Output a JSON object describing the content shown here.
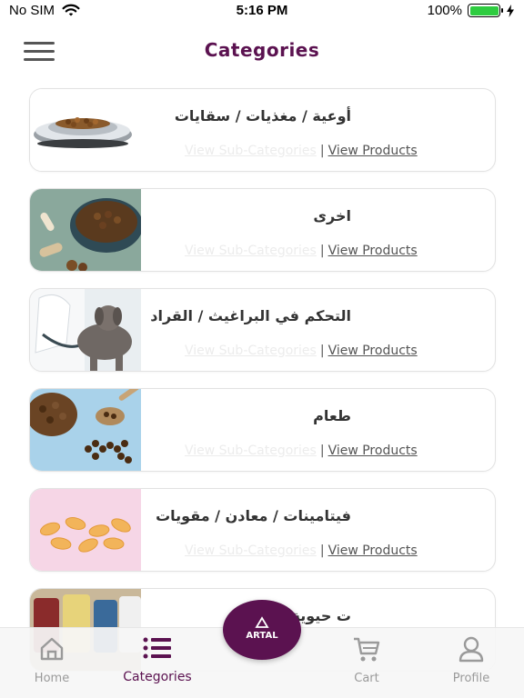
{
  "status_bar": {
    "carrier": "No SIM",
    "time": "5:16 PM",
    "battery_pct": "100%",
    "battery_level": 1.0
  },
  "header": {
    "title": "Categories",
    "menu_icon": "hamburger-menu-icon"
  },
  "card_links": {
    "sub_categories": "View Sub-Categories",
    "separator": "|",
    "products": "View Products"
  },
  "categories": [
    {
      "name": "أوعية / مغذيات / سقايات",
      "image": "pet-food-bowl"
    },
    {
      "name": "اخرى",
      "image": "dog-treats-and-kibble"
    },
    {
      "name": "التحكم في البراغيث / القراد",
      "image": "vet-with-puppy"
    },
    {
      "name": "طعام",
      "image": "kibble-spoon"
    },
    {
      "name": "فيتامينات / معادن / مقويات",
      "image": "vitamin-capsules"
    },
    {
      "name": "ت حيوية",
      "image": "supplement-bottles"
    }
  ],
  "nav": {
    "home": {
      "label": "Home",
      "icon": "home-icon"
    },
    "categories": {
      "label": "Categories",
      "icon": "list-icon"
    },
    "fab": {
      "label": "ARTAL",
      "icon": "artal-logo-icon"
    },
    "cart": {
      "label": "Cart",
      "icon": "cart-icon"
    },
    "profile": {
      "label": "Profile",
      "icon": "user-icon"
    }
  },
  "colors": {
    "brand": "#5b1250",
    "battery": "#2ecc40",
    "nav_inactive": "#9a9a9a"
  }
}
